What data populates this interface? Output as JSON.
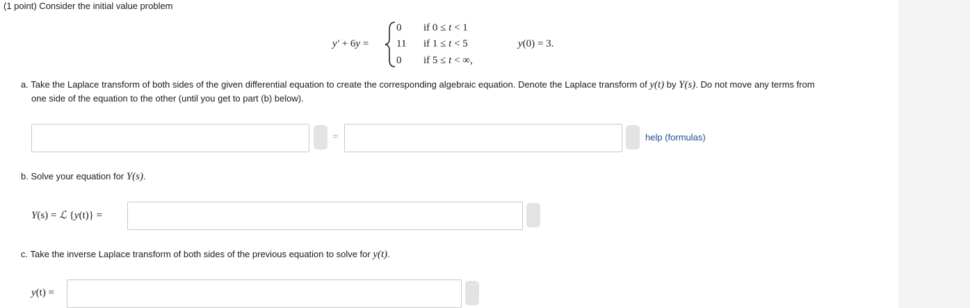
{
  "problem": {
    "header": "(1 point) Consider the initial value problem",
    "lhs": {
      "yprime": "y′",
      "plus": "+ 6",
      "y": "y",
      "eq": "="
    },
    "cases": [
      {
        "value": "0",
        "cond_if": "if 0 ≤ ",
        "t": "t",
        "cond_rest": " < 1"
      },
      {
        "value": "11",
        "cond_if": "if 1 ≤ ",
        "t": "t",
        "cond_rest": " < 5"
      },
      {
        "value": "0",
        "cond_if": "if 5 ≤ ",
        "t": "t",
        "cond_rest": " < ∞,"
      }
    ],
    "initial_condition": {
      "y": "y",
      "rest": "(0) = 3."
    }
  },
  "part_a": {
    "text_1": "a. Take the Laplace transform of both sides of the given differential equation to create the corresponding algebraic equation. Denote the Laplace transform of ",
    "y_of_t": "y(t)",
    "text_2": " by ",
    "Y_of_s": "Y(s)",
    "text_3": ". Do not move any terms from",
    "text_4": "one side of the equation to the other (until you get to part (b) below).",
    "equals": "=",
    "left_value": "",
    "right_value": "",
    "help_link": "help (formulas)"
  },
  "part_b": {
    "text": "b. Solve your equation for ",
    "Y_of_s": "Y(s)",
    "period": ".",
    "lhs_Y": "Y",
    "lhs_s": "(s) = ",
    "lhs_L": "ℒ",
    "lhs_brace": " {",
    "lhs_y": "y",
    "lhs_t": "(t)} =",
    "value": ""
  },
  "part_c": {
    "text": "c. Take the inverse Laplace transform of both sides of the previous equation to solve for ",
    "y_of_t": "y(t)",
    "period": ".",
    "lhs_y": "y",
    "lhs_rest": "(t) =",
    "value": ""
  }
}
